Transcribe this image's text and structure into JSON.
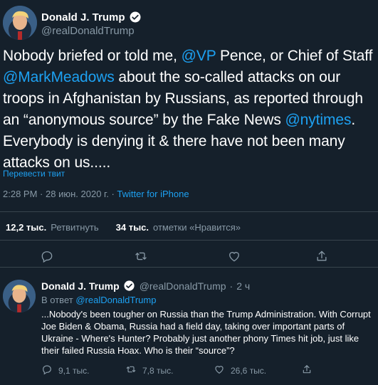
{
  "main_tweet": {
    "author_name": "Donald J. Trump",
    "author_handle": "@realDonaldTrump",
    "text_parts": {
      "p1": "Nobody briefed or told me, ",
      "m1": "@VP",
      "p2": " Pence, or Chief of Staff ",
      "m2": "@MarkMeadows",
      "p3": " about the so-called attacks on our troops in Afghanistan by Russians, as reported through an “anonymous source” by the Fake News ",
      "m3": "@nytimes",
      "p4": ". Everybody is denying it & there have not been many attacks on us....."
    },
    "translate_link": "Перевести твит",
    "time": "2:28 PM",
    "date": "28 июн. 2020 г.",
    "separator": "·",
    "source": "Twitter for iPhone",
    "retweets_count": "12,2 тыс.",
    "retweets_label": "Ретвитнуть",
    "likes_count": "34 тыс.",
    "likes_label": "отметки «Нравится»",
    "icons": [
      "reply-icon",
      "retweet-icon",
      "like-icon",
      "share-icon"
    ]
  },
  "reply_tweet": {
    "author_name": "Donald J. Trump",
    "author_handle": "@realDonaldTrump",
    "dot": "·",
    "age": "2 ч",
    "reply_to_label": "В ответ",
    "reply_to_handle": "@realDonaldTrump",
    "text": "...Nobody's been tougher on Russia than the Trump Administration. With Corrupt Joe Biden & Obama, Russia had a field day, taking over important parts of Ukraine - Where's Hunter? Probably just another phony Times hit job, just like their failed Russia Hoax. Who is their “source”?",
    "replies": "9,1 тыс.",
    "retweets": "7,8 тыс.",
    "likes": "26,6 тыс."
  },
  "colors": {
    "background": "#15202b",
    "accent": "#1da1f2",
    "muted": "#8899a6",
    "divider": "#38444d"
  }
}
